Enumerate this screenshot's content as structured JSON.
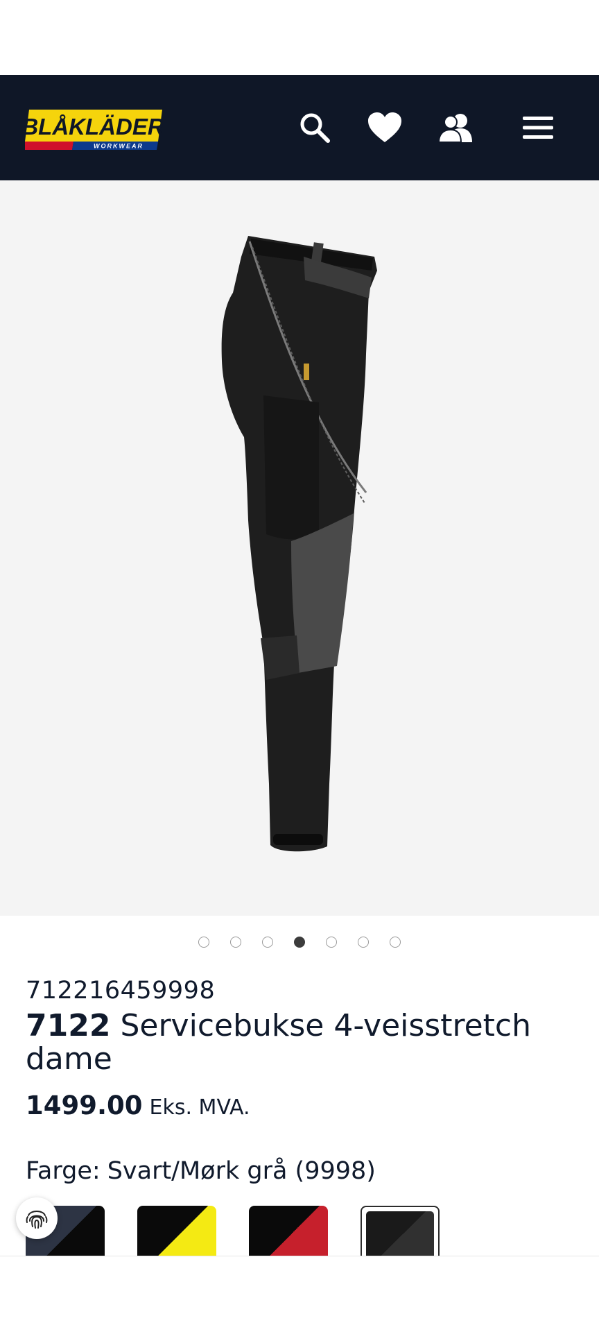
{
  "brand": {
    "logo_text": "BLÅKLÄDER",
    "logo_subtext": "WORKWEAR",
    "colors": {
      "header_bg": "#0f1727",
      "logo_yellow": "#f5d40c",
      "logo_blue": "#0d3a8c",
      "logo_red": "#d0112b"
    }
  },
  "header": {
    "icons": [
      "search-icon",
      "heart-icon",
      "account-icon",
      "menu-icon"
    ]
  },
  "gallery": {
    "image_count": 7,
    "active_index": 3
  },
  "product": {
    "sku": "712216459998",
    "model": "7122",
    "name": "Servicebukse 4-veisstretch dame",
    "price": "1499.00",
    "vat_note": "Eks. MVA.",
    "color_label": "Farge:",
    "color_value": "Svart/Mørk grå (9998)"
  },
  "swatches": [
    {
      "name": "dark-navy-black",
      "colors": [
        "#2d3444",
        "#0a0a0a"
      ],
      "selected": false
    },
    {
      "name": "black-yellow",
      "colors": [
        "#0a0a0a",
        "#f4ea13"
      ],
      "selected": false
    },
    {
      "name": "black-red",
      "colors": [
        "#0a0a0a",
        "#c6202c"
      ],
      "selected": false
    },
    {
      "name": "black-dark-grey",
      "colors": [
        "#1a1a1a",
        "#303030"
      ],
      "selected": true
    }
  ]
}
